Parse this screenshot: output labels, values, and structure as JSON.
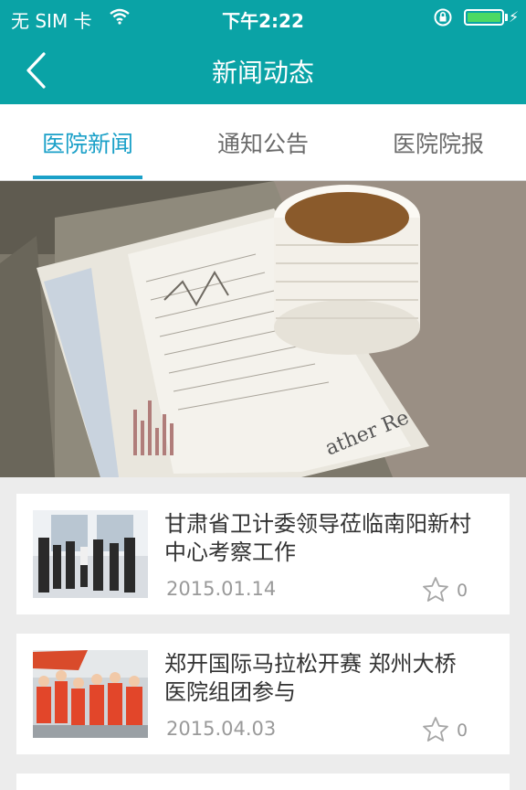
{
  "status_bar": {
    "carrier": "无 SIM 卡",
    "time": "下午2:22",
    "battery_level": 1.0
  },
  "nav": {
    "title": "新闻动态"
  },
  "tabs": [
    {
      "label": "医院新闻",
      "active": true
    },
    {
      "label": "通知公告",
      "active": false
    },
    {
      "label": "医院院报",
      "active": false
    }
  ],
  "news": [
    {
      "title": "甘肃省卫计委领导莅临南阳新村中心考察工作",
      "date": "2015.01.14",
      "favorites": "0"
    },
    {
      "title": "郑开国际马拉松开赛 郑州大桥医院组团参与",
      "date": "2015.04.03",
      "favorites": "0"
    }
  ],
  "colors": {
    "header": "#0aa3a6",
    "tab_active": "#1aa0c8",
    "battery": "#4cd964"
  }
}
